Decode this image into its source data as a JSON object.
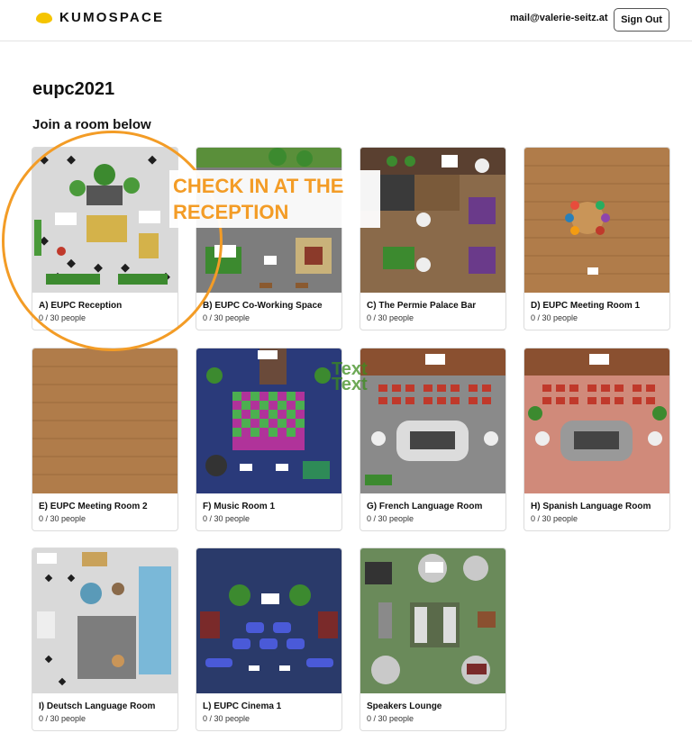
{
  "header": {
    "logo_text": "KUMOSPACE",
    "user_email": "mail@valerie-seitz.at",
    "signout_label": "Sign Out"
  },
  "page": {
    "title": "eupc2021",
    "section_title": "Join a room below"
  },
  "rooms": [
    {
      "name": "A) EUPC Reception",
      "count": "0 / 30 people",
      "theme": "reception"
    },
    {
      "name": "B) EUPC Co-Working Space",
      "count": "0 / 30 people",
      "theme": "coworking"
    },
    {
      "name": "C) The Permie Palace Bar",
      "count": "0 / 30 people",
      "theme": "bar"
    },
    {
      "name": "D) EUPC Meeting Room 1",
      "count": "0 / 30 people",
      "theme": "meeting"
    },
    {
      "name": "E) EUPC Meeting Room 2",
      "count": "0 / 30 people",
      "theme": "empty-wood"
    },
    {
      "name": "F) Music Room 1",
      "count": "0 / 30 people",
      "theme": "music"
    },
    {
      "name": "G) French Language Room",
      "count": "0 / 30 people",
      "theme": "language-gray"
    },
    {
      "name": "H) Spanish Language Room",
      "count": "0 / 30 people",
      "theme": "language-tile"
    },
    {
      "name": "I) Deutsch Language Room",
      "count": "0 / 30 people",
      "theme": "pool"
    },
    {
      "name": "L) EUPC Cinema 1",
      "count": "0 / 30 people",
      "theme": "cinema"
    },
    {
      "name": "Speakers Lounge",
      "count": "0 / 30 people",
      "theme": "lounge"
    }
  ],
  "annotation": {
    "line1": "CHECK IN AT THE",
    "line2": "RECEPTION",
    "color": "#f39c26"
  },
  "overlay_text": [
    "Text",
    "Text"
  ],
  "colors": {
    "brand_yellow": "#f5c400",
    "card_border": "#dcdcdc"
  }
}
